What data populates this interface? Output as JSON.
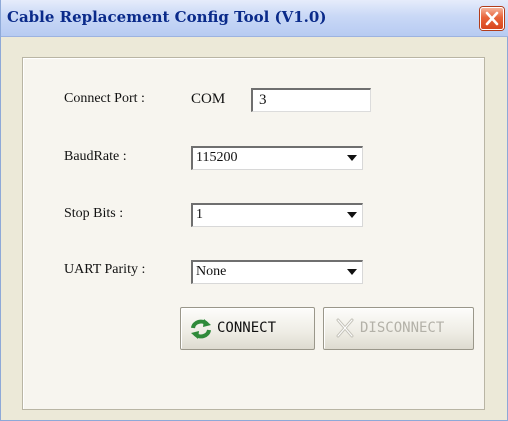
{
  "window": {
    "title": "Cable Replacement Config Tool (V1.0)"
  },
  "form": {
    "connect_port_label": "Connect Port :",
    "com_label": "COM",
    "port_value": "3",
    "baud_label": "BaudRate :",
    "baud_value": "115200",
    "stop_bits_label": "Stop Bits :",
    "stop_bits_value": "1",
    "parity_label": "UART Parity :",
    "parity_value": "None"
  },
  "buttons": {
    "connect_label": "CONNECT",
    "disconnect_label": "DISCONNECT"
  },
  "icons": {
    "close": "close-icon",
    "dropdown": "chevron-down-icon",
    "connect": "refresh-icon",
    "disconnect": "disconnect-x-icon"
  },
  "colors": {
    "close_button": "#e8643a",
    "connect_icon": "#2f8a3a",
    "title_text": "#0a2a8a"
  }
}
